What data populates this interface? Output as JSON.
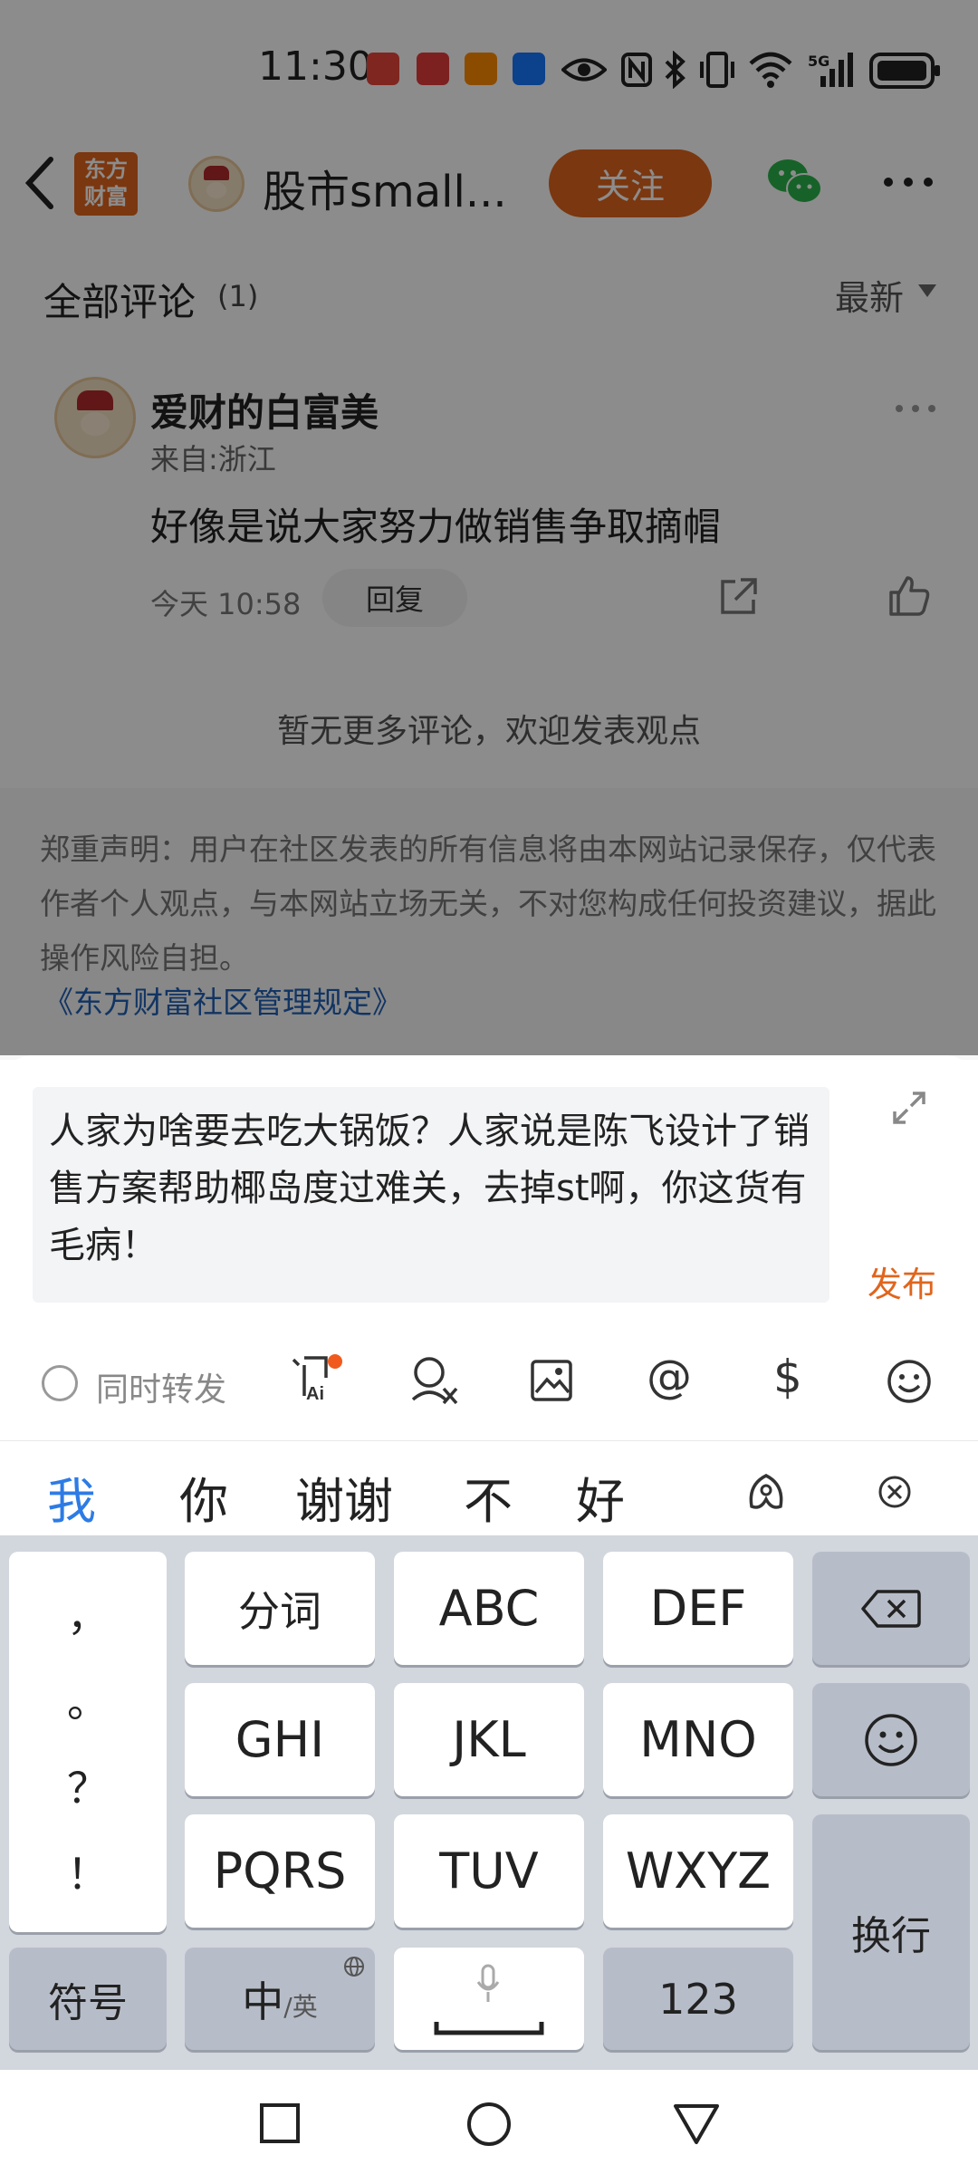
{
  "status_bar": {
    "time": "11:30",
    "network": "5G",
    "icons": [
      "app-notification-icon",
      "app-notification-icon",
      "taobao-icon",
      "alipay-icon",
      "eye-icon",
      "nfc-icon",
      "bluetooth-icon",
      "vibrate-icon",
      "wifi-icon",
      "signal-icon",
      "battery-icon"
    ]
  },
  "nav": {
    "back_icon": "chevron-left-icon",
    "app_logo_text": "东方\n财富",
    "title": "股市small...",
    "follow_label": "关注",
    "wechat_icon": "wechat-icon",
    "more_icon": "more-icon"
  },
  "comments_section": {
    "title": "全部评论",
    "count": "(1)",
    "sort_label": "最新"
  },
  "comment": {
    "author": "爱财的白富美",
    "location": "来自:浙江",
    "text": "好像是说大家努力做销售争取摘帽",
    "time": "今天 10:58",
    "reply_label": "回复"
  },
  "no_more_text": "暂无更多评论，欢迎发表观点",
  "disclaimer": {
    "text": "郑重声明：用户在社区发表的所有信息将由本网站记录保存，仅代表作者个人观点，与本网站立场无关，不对您构成任何投资建议，据此操作风险自担。",
    "link": "《东方财富社区管理规定》"
  },
  "composer": {
    "input_value": "人家为啥要去吃大锅饭？人家说是陈飞设计了销售方案帮助椰岛度过难关，去掉st啊，你这货有毛病！",
    "publish_label": "发布",
    "repost_label": "同时转发",
    "accent_color": "#e0651d"
  },
  "candidates": [
    "我",
    "你",
    "谢谢",
    "不",
    "好"
  ],
  "keyboard": {
    "punct_keys": [
      "，",
      "。",
      "？",
      "！"
    ],
    "row1": [
      "分词",
      "ABC",
      "DEF"
    ],
    "row2": [
      "GHI",
      "JKL",
      "MNO"
    ],
    "row3": [
      "PQRS",
      "TUV",
      "WXYZ"
    ],
    "symbols_label": "符号",
    "lang_main": "中",
    "lang_sub": "/英",
    "num_label": "123",
    "enter_label": "换行"
  },
  "colors": {
    "brand_orange": "#e0651d",
    "link_blue": "#1f5fb5",
    "candidate_active": "#2d7be5"
  }
}
